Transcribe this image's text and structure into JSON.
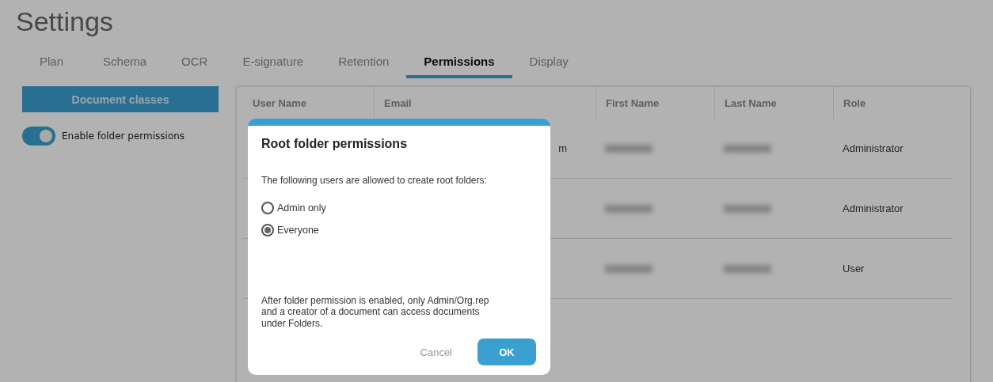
{
  "page": {
    "title": "Settings"
  },
  "tabs": [
    {
      "label": "Plan",
      "selected": false
    },
    {
      "label": "Schema",
      "selected": false
    },
    {
      "label": "OCR",
      "selected": false
    },
    {
      "label": "E-signature",
      "selected": false
    },
    {
      "label": "Retention",
      "selected": false
    },
    {
      "label": "Permissions",
      "selected": true
    },
    {
      "label": "Display",
      "selected": false
    }
  ],
  "sidebar": {
    "button": "Document classes",
    "toggle": {
      "label": "Enable folder permissions",
      "on": true
    }
  },
  "table": {
    "columns": [
      "User Name",
      "Email",
      "First Name",
      "Last Name",
      "Role"
    ],
    "rows": [
      {
        "email": "m",
        "first_blurred": true,
        "last_blurred": true,
        "role": "Administrator"
      },
      {
        "first_blurred": true,
        "last_blurred": true,
        "role": "Administrator"
      },
      {
        "first_blurred": true,
        "last_blurred": true,
        "role": "User"
      }
    ]
  },
  "dialog": {
    "title": "Root folder permissions",
    "prompt": "The following users are allowed to create root folders:",
    "options": [
      {
        "label": "Admin only",
        "selected": false
      },
      {
        "label": "Everyone",
        "selected": true
      }
    ],
    "note": "After folder permission is enabled, only Admin/Org.rep and a creator of a document can access documents under Folders.",
    "buttons": [
      {
        "label": "Cancel",
        "kind": "text"
      },
      {
        "label": "OK",
        "kind": "primary"
      }
    ]
  }
}
